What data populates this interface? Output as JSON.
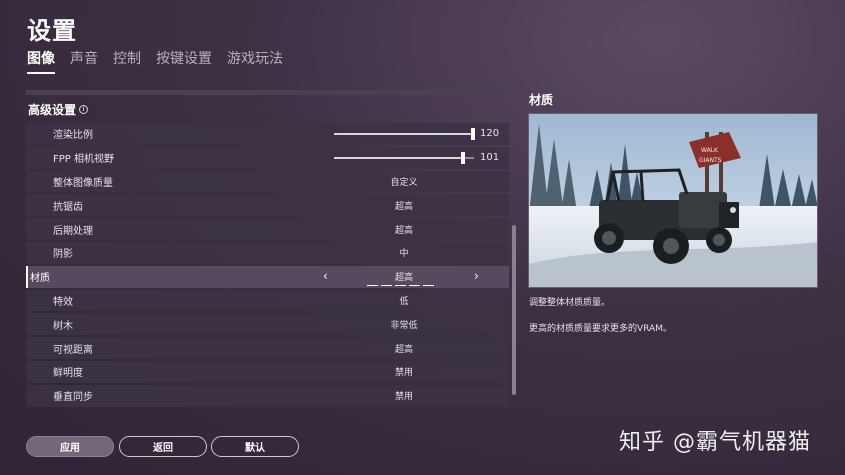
{
  "page": {
    "title": "设置"
  },
  "tabs": [
    {
      "label": "图像",
      "active": true
    },
    {
      "label": "声音",
      "active": false
    },
    {
      "label": "控制",
      "active": false
    },
    {
      "label": "按键设置",
      "active": false
    },
    {
      "label": "游戏玩法",
      "active": false
    }
  ],
  "advanced": {
    "header": "高级设置",
    "rows": [
      {
        "label": "渲染比例",
        "slider_value": "120",
        "slider_fraction": 0.99
      },
      {
        "label": "FPP 相机视野",
        "slider_value": "101",
        "slider_fraction": 0.92
      },
      {
        "label": "整体图像质量",
        "value": "自定义"
      },
      {
        "label": "抗锯齿",
        "value": "超高"
      },
      {
        "label": "后期处理",
        "value": "超高"
      },
      {
        "label": "阴影",
        "value": "中"
      },
      {
        "label": "材质",
        "value": "超高",
        "selected": true,
        "level_total": 5,
        "level_selected": 5
      },
      {
        "label": "特效",
        "value": "低"
      },
      {
        "label": "树木",
        "value": "非常低"
      },
      {
        "label": "可视距离",
        "value": "超高"
      },
      {
        "label": "鲜明度",
        "value": "禁用"
      },
      {
        "label": "垂直同步",
        "value": "禁用"
      }
    ]
  },
  "detail": {
    "title": "材质",
    "desc1": "调整整体材质质量。",
    "desc2": "更高的材质质量要求更多的VRAM。"
  },
  "buttons": {
    "apply": "应用",
    "back": "返回",
    "defaults": "默认"
  },
  "watermark": "知乎 @霸气机器猫",
  "icons": {
    "info": "info-icon",
    "prev": "chevron-left-icon",
    "next": "chevron-right-icon"
  },
  "colors": {
    "selected_row": "#584c60",
    "row": "#3c3244",
    "background": "#3d3043"
  }
}
